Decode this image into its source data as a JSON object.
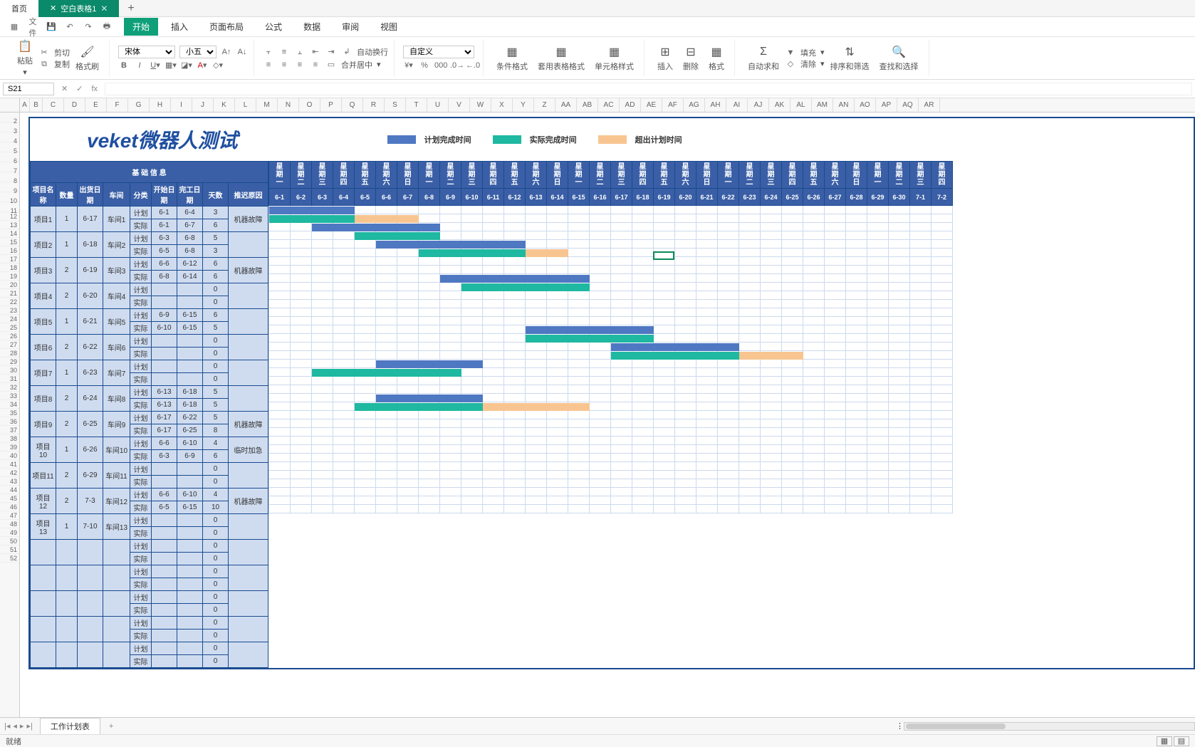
{
  "tabs": {
    "home": "首页",
    "doc": "空白表格1"
  },
  "menu": {
    "file": "文件",
    "start": "开始",
    "insert": "插入",
    "layout": "页面布局",
    "formula": "公式",
    "data": "数据",
    "review": "审阅",
    "view": "视图"
  },
  "clip": {
    "paste": "粘贴",
    "cut": "剪切",
    "copy": "复制",
    "painter": "格式刷"
  },
  "font": {
    "name": "宋体",
    "size": "小五"
  },
  "align": {
    "wrap": "自动换行",
    "merge": "合并居中"
  },
  "numfmt": "自定义",
  "styles": {
    "cond": "条件格式",
    "tbl": "套用表格格式",
    "cell": "单元格样式"
  },
  "cells": {
    "insert": "插入",
    "delete": "删除",
    "format": "格式"
  },
  "edit": {
    "sum": "自动求和",
    "fill": "填充",
    "clear": "清除",
    "sort": "排序和筛选",
    "find": "查找和选择"
  },
  "namebox": "S21",
  "fx": "fx",
  "cols": [
    "A",
    "B",
    "C",
    "D",
    "E",
    "F",
    "G",
    "H",
    "I",
    "J",
    "K",
    "L",
    "M",
    "N",
    "O",
    "P",
    "Q",
    "R",
    "S",
    "T",
    "U",
    "V",
    "W",
    "X",
    "Y",
    "Z",
    "AA",
    "AB",
    "AC",
    "AD",
    "AE",
    "AF",
    "AG",
    "AH",
    "AI",
    "AJ",
    "AK",
    "AL",
    "AM",
    "AN",
    "AO",
    "AP",
    "AQ",
    "AR"
  ],
  "rows_before": [
    3,
    4,
    5,
    6,
    7,
    8,
    9,
    10,
    11,
    12,
    13,
    14,
    15,
    16,
    17,
    18,
    19,
    20,
    21,
    22,
    23,
    24,
    25,
    26,
    27,
    28,
    29,
    30,
    31,
    32,
    33,
    34,
    35,
    36,
    37,
    38,
    39,
    40,
    41,
    42,
    43,
    44,
    45,
    46,
    47,
    48,
    49,
    50,
    51,
    52
  ],
  "title": "veket微器人测试",
  "legend": {
    "plan": "计划完成时间",
    "actual": "实际完成时间",
    "over": "超出计划时间"
  },
  "lthdr": {
    "group": "基 础 信 息",
    "name": "项目名称",
    "qty": "数量",
    "ship": "出货日期",
    "shop": "车间",
    "type": "分类",
    "start": "开始日期",
    "end": "完工日期",
    "days": "天数",
    "reason": "推迟原因"
  },
  "types": {
    "plan": "计划",
    "actual": "实际"
  },
  "reasons": {
    "machine": "机器故障",
    "rush": "临时加急"
  },
  "weekdays": [
    "星期一",
    "星期二",
    "星期三",
    "星期四",
    "星期五",
    "星期六",
    "星期日",
    "星期一",
    "星期二",
    "星期三",
    "星期四",
    "星期五",
    "星期六",
    "星期日",
    "星期一",
    "星期二",
    "星期三",
    "星期四",
    "星期五",
    "星期六",
    "星期日",
    "星期一",
    "星期二",
    "星期三",
    "星期四",
    "星期五",
    "星期六",
    "星期日",
    "星期一",
    "星期二",
    "星期三",
    "星期四"
  ],
  "dates": [
    "6-1",
    "6-2",
    "6-3",
    "6-4",
    "6-5",
    "6-6",
    "6-7",
    "6-8",
    "6-9",
    "6-10",
    "6-11",
    "6-12",
    "6-13",
    "6-14",
    "6-15",
    "6-16",
    "6-17",
    "6-18",
    "6-19",
    "6-20",
    "6-21",
    "6-22",
    "6-23",
    "6-24",
    "6-25",
    "6-26",
    "6-27",
    "6-28",
    "6-29",
    "6-30",
    "7-1",
    "7-2"
  ],
  "projects": [
    {
      "name": "项目1",
      "qty": "1",
      "ship": "6-17",
      "shop": "车间1",
      "plan": {
        "s": "6-1",
        "e": "6-4",
        "d": "3"
      },
      "act": {
        "s": "6-1",
        "e": "6-7",
        "d": "6"
      },
      "reason": "机器故障",
      "bars": {
        "p": [
          0,
          4
        ],
        "a": [
          0,
          7
        ],
        "o": [
          4,
          7
        ]
      }
    },
    {
      "name": "项目2",
      "qty": "1",
      "ship": "6-18",
      "shop": "车间2",
      "plan": {
        "s": "6-3",
        "e": "6-8",
        "d": "5"
      },
      "act": {
        "s": "6-5",
        "e": "6-8",
        "d": "3"
      },
      "reason": "",
      "bars": {
        "p": [
          2,
          8
        ],
        "a": [
          4,
          8
        ]
      }
    },
    {
      "name": "项目3",
      "qty": "2",
      "ship": "6-19",
      "shop": "车间3",
      "plan": {
        "s": "6-6",
        "e": "6-12",
        "d": "6"
      },
      "act": {
        "s": "6-8",
        "e": "6-14",
        "d": "6"
      },
      "reason": "机器故障",
      "bars": {
        "p": [
          5,
          12
        ],
        "a": [
          7,
          14
        ],
        "o": [
          12,
          14
        ]
      }
    },
    {
      "name": "项目4",
      "qty": "2",
      "ship": "6-20",
      "shop": "车间4",
      "plan": {
        "s": "",
        "e": "",
        "d": "0"
      },
      "act": {
        "s": "",
        "e": "",
        "d": "0"
      },
      "reason": ""
    },
    {
      "name": "项目5",
      "qty": "1",
      "ship": "6-21",
      "shop": "车间5",
      "plan": {
        "s": "6-9",
        "e": "6-15",
        "d": "6"
      },
      "act": {
        "s": "6-10",
        "e": "6-15",
        "d": "5"
      },
      "reason": "",
      "bars": {
        "p": [
          8,
          15
        ],
        "a": [
          9,
          15
        ]
      }
    },
    {
      "name": "项目6",
      "qty": "2",
      "ship": "6-22",
      "shop": "车间6",
      "plan": {
        "s": "",
        "e": "",
        "d": "0"
      },
      "act": {
        "s": "",
        "e": "",
        "d": "0"
      },
      "reason": ""
    },
    {
      "name": "项目7",
      "qty": "1",
      "ship": "6-23",
      "shop": "车间7",
      "plan": {
        "s": "",
        "e": "",
        "d": "0"
      },
      "act": {
        "s": "",
        "e": "",
        "d": "0"
      },
      "reason": ""
    },
    {
      "name": "项目8",
      "qty": "2",
      "ship": "6-24",
      "shop": "车间8",
      "plan": {
        "s": "6-13",
        "e": "6-18",
        "d": "5"
      },
      "act": {
        "s": "6-13",
        "e": "6-18",
        "d": "5"
      },
      "reason": "",
      "bars": {
        "p": [
          12,
          18
        ],
        "a": [
          12,
          18
        ]
      }
    },
    {
      "name": "项目9",
      "qty": "2",
      "ship": "6-25",
      "shop": "车间9",
      "plan": {
        "s": "6-17",
        "e": "6-22",
        "d": "5"
      },
      "act": {
        "s": "6-17",
        "e": "6-25",
        "d": "8"
      },
      "reason": "机器故障",
      "bars": {
        "p": [
          16,
          22
        ],
        "a": [
          16,
          25
        ],
        "o": [
          22,
          25
        ]
      }
    },
    {
      "name": "项目10",
      "qty": "1",
      "ship": "6-26",
      "shop": "车间10",
      "plan": {
        "s": "6-6",
        "e": "6-10",
        "d": "4"
      },
      "act": {
        "s": "6-3",
        "e": "6-9",
        "d": "6"
      },
      "reason": "临时加急",
      "bars": {
        "p": [
          5,
          10
        ],
        "a": [
          2,
          9
        ]
      }
    },
    {
      "name": "项目11",
      "qty": "2",
      "ship": "6-29",
      "shop": "车间11",
      "plan": {
        "s": "",
        "e": "",
        "d": "0"
      },
      "act": {
        "s": "",
        "e": "",
        "d": "0"
      },
      "reason": ""
    },
    {
      "name": "项目12",
      "qty": "2",
      "ship": "7-3",
      "shop": "车间12",
      "plan": {
        "s": "6-6",
        "e": "6-10",
        "d": "4"
      },
      "act": {
        "s": "6-5",
        "e": "6-15",
        "d": "10"
      },
      "reason": "机器故障",
      "bars": {
        "p": [
          5,
          10
        ],
        "a": [
          4,
          15
        ],
        "o": [
          10,
          15
        ]
      }
    },
    {
      "name": "项目13",
      "qty": "1",
      "ship": "7-10",
      "shop": "车间13",
      "plan": {
        "s": "",
        "e": "",
        "d": "0"
      },
      "act": {
        "s": "",
        "e": "",
        "d": "0"
      },
      "reason": ""
    },
    {
      "plan": {
        "d": "0"
      },
      "act": {
        "d": "0"
      }
    },
    {
      "plan": {
        "d": "0"
      },
      "act": {
        "d": "0"
      }
    },
    {
      "plan": {
        "d": "0"
      },
      "act": {
        "d": "0"
      }
    },
    {
      "plan": {
        "d": "0"
      },
      "act": {
        "d": "0"
      }
    },
    {
      "plan": {
        "d": "0"
      },
      "act": {
        "d": "0"
      }
    }
  ],
  "chart_data": {
    "type": "gantt",
    "title": "veket微器人测试",
    "x_dates": [
      "6-1",
      "6-2",
      "6-3",
      "6-4",
      "6-5",
      "6-6",
      "6-7",
      "6-8",
      "6-9",
      "6-10",
      "6-11",
      "6-12",
      "6-13",
      "6-14",
      "6-15",
      "6-16",
      "6-17",
      "6-18",
      "6-19",
      "6-20",
      "6-21",
      "6-22",
      "6-23",
      "6-24",
      "6-25",
      "6-26",
      "6-27",
      "6-28",
      "6-29",
      "6-30",
      "7-1",
      "7-2"
    ],
    "series_legend": {
      "plan": "计划完成时间",
      "actual": "实际完成时间",
      "over": "超出计划时间"
    },
    "tasks": [
      {
        "name": "项目1",
        "plan": [
          "6-1",
          "6-4"
        ],
        "actual": [
          "6-1",
          "6-7"
        ],
        "over": [
          "6-4",
          "6-7"
        ]
      },
      {
        "name": "项目2",
        "plan": [
          "6-3",
          "6-8"
        ],
        "actual": [
          "6-5",
          "6-8"
        ]
      },
      {
        "name": "项目3",
        "plan": [
          "6-6",
          "6-12"
        ],
        "actual": [
          "6-8",
          "6-14"
        ],
        "over": [
          "6-12",
          "6-14"
        ]
      },
      {
        "name": "项目5",
        "plan": [
          "6-9",
          "6-15"
        ],
        "actual": [
          "6-10",
          "6-15"
        ]
      },
      {
        "name": "项目8",
        "plan": [
          "6-13",
          "6-18"
        ],
        "actual": [
          "6-13",
          "6-18"
        ]
      },
      {
        "name": "项目9",
        "plan": [
          "6-17",
          "6-22"
        ],
        "actual": [
          "6-17",
          "6-25"
        ],
        "over": [
          "6-22",
          "6-25"
        ]
      },
      {
        "name": "项目10",
        "plan": [
          "6-6",
          "6-10"
        ],
        "actual": [
          "6-3",
          "6-9"
        ]
      },
      {
        "name": "项目12",
        "plan": [
          "6-6",
          "6-10"
        ],
        "actual": [
          "6-5",
          "6-15"
        ],
        "over": [
          "6-10",
          "6-15"
        ]
      }
    ]
  },
  "sheetname": "工作计划表",
  "status": "就绪"
}
